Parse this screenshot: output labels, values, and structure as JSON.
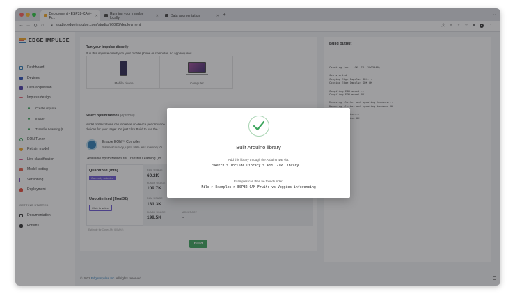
{
  "browser": {
    "tabs": [
      {
        "label": "Deployment - ESP32-CAM-Fr...",
        "favicon_color": "#f5a623"
      },
      {
        "label": "Running your impulse locally",
        "favicon_color": "#444444"
      },
      {
        "label": "Data augmentation",
        "favicon_color": "#444444"
      }
    ],
    "url": "studio.edgeimpulse.com/studio/76025/deployment",
    "traffic_colors": [
      "#fe5f57",
      "#febc2e",
      "#28c840"
    ]
  },
  "sidebar": {
    "brand": "EDGE IMPULSE",
    "items": [
      {
        "label": "Dashboard",
        "color": "#2a7ab8"
      },
      {
        "label": "Devices",
        "color": "#2a4fb8"
      },
      {
        "label": "Data acquisition",
        "color": "#4a3aa8"
      },
      {
        "label": "Impulse design",
        "color": "#e85d75"
      }
    ],
    "subitems": [
      "Create impulse",
      "Image",
      "Transfer Learning (I..."
    ],
    "items2": [
      {
        "label": "EON Tuner",
        "color": "#3ba55c"
      },
      {
        "label": "Retrain model",
        "color": "#f5a623"
      },
      {
        "label": "Live classification",
        "color": "#d94e8f"
      },
      {
        "label": "Model testing",
        "color": "#e85d4a"
      },
      {
        "label": "Versioning",
        "color": "#7a4fb8"
      },
      {
        "label": "Deployment",
        "color": "#e84a3a"
      }
    ],
    "section_label": "GETTING STARTED",
    "items3": [
      {
        "label": "Documentation",
        "color": "#333333"
      },
      {
        "label": "Forums",
        "color": "#333333"
      }
    ]
  },
  "run_directly": {
    "title": "Run your impulse directly",
    "description": "Run this impulse directly on your mobile phone or computer, no app required.",
    "devices": [
      "Mobile phone",
      "Computer"
    ]
  },
  "optimizations": {
    "title": "Select optimizations",
    "optional": "(optional)",
    "description_1": "Model optimizations can increase on-device performance...",
    "description_2": "choices for your target. Or, just click Build to use the r...",
    "eon_title": "Enable EON™ Compiler",
    "eon_subtitle": "Same accuracy, up to 50% less memory. O...",
    "available_title": "Available optimizations for Transfer Learning (Im...",
    "quantized": {
      "name": "Quantized (int8)",
      "badge": "Currently selected",
      "ram_label": "RAM USAGE",
      "ram": "60.2K",
      "flash_label": "FLASH USAGE",
      "flash": "109.7K"
    },
    "unoptimized": {
      "name": "Unoptimized (float32)",
      "button": "Click to select",
      "ram_label": "RAM USAGE",
      "ram": "131.3K",
      "flash_label": "FLASH USAGE",
      "flash": "199.5K",
      "accuracy_label": "ACCURACY",
      "accuracy": "-"
    },
    "footnote": "Estimate for Cortex-M4 (80MHz)",
    "build_label": "Build"
  },
  "footer": {
    "prefix": "© 2022",
    "link": "EdgeImpulse Inc.",
    "suffix": "All rights reserved"
  },
  "build_output": {
    "title": "Build output",
    "lines": [
      "Creating job... OK (ID: 1903040)",
      "",
      "Job started",
      "Copying Edge Impulse SDK...",
      "Copying Edge Impulse SDK OK",
      "",
      "Compiling EON model...",
      "Compiling EON model OK",
      "",
      "Removing clutter and updating headers...",
      "Removing clutter and updating headers OK",
      "",
      "Creating archive...",
      "Creating archive OK"
    ]
  },
  "modal": {
    "title": "Built Arduino library",
    "line1": "Add this library through the Arduino IDE via:",
    "code1": "Sketch > Include Library > Add .ZIP Library...",
    "line2": "Examples can then be found under:",
    "code2": "File > Examples > ESP32-CAM-Fruits-vs-Veggies_inferencing",
    "success_color": "#3ba55c"
  }
}
